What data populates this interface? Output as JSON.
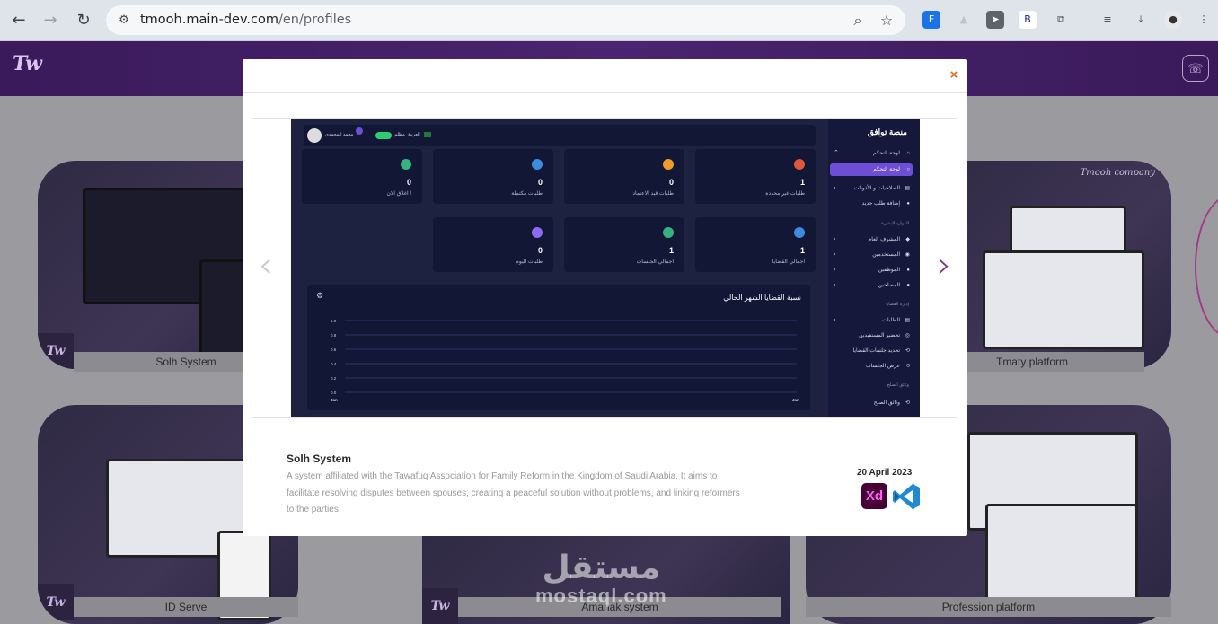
{
  "browser": {
    "url_host": "tmooh.main-dev.com",
    "url_path": "/en/profiles",
    "nav": {
      "back": "←",
      "forward": "→",
      "reload": "↻"
    },
    "omnibox_icons": [
      "site-info-icon",
      "zoom-icon",
      "star-icon"
    ],
    "extensions": [
      {
        "name": "translate-extension-icon",
        "glyph": "F",
        "bg": "#1a73e8",
        "fg": "#ffffff"
      },
      {
        "name": "gray-extension-icon",
        "glyph": "▲",
        "bg": "transparent",
        "fg": "#bfc3c9"
      },
      {
        "name": "cursor-extension-icon",
        "glyph": "➤",
        "bg": "#5f6368",
        "fg": "#ffffff"
      },
      {
        "name": "b-extension-icon",
        "glyph": "B",
        "bg": "#ffffff",
        "fg": "#1a237e"
      },
      {
        "name": "puzzle-icon",
        "glyph": "⧉",
        "bg": "transparent",
        "fg": "#3c4043"
      },
      {
        "name": "media-queue-icon",
        "glyph": "≡",
        "bg": "transparent",
        "fg": "#3c4043"
      },
      {
        "name": "download-icon",
        "glyph": "⤓",
        "bg": "transparent",
        "fg": "#3c4043"
      },
      {
        "name": "profile-avatar-icon",
        "glyph": "●",
        "bg": "#e8e8e8",
        "fg": "#333333"
      },
      {
        "name": "menu-kebab-icon",
        "glyph": "⋮",
        "bg": "transparent",
        "fg": "#3c4043"
      }
    ]
  },
  "site": {
    "logo": "Tw",
    "header_button_icon": "chat-icon",
    "cards": [
      {
        "label": "Solh System"
      },
      {
        "label": "Tmaty platform",
        "corner_text": "Tmooh company"
      },
      {
        "label": "ID Serve"
      },
      {
        "label": "Amanak system"
      },
      {
        "label": "Profession platform"
      }
    ],
    "watermark": {
      "arabic": "مستقل",
      "latin": "mostaql.com"
    }
  },
  "modal": {
    "close": "×",
    "carousel": {
      "prev": "‹",
      "next": "›"
    },
    "dashboard": {
      "brand": "منصة توافق",
      "user_name": "محمد المحمدي",
      "lang_label": "العربية",
      "mode_label": "مظلم",
      "stats_row1": [
        {
          "num": "1",
          "label": "طلبات غير محددة",
          "color": "#e0573d"
        },
        {
          "num": "0",
          "label": "طلبات قيد الاعتماد",
          "color": "#f09a2a"
        },
        {
          "num": "0",
          "label": "طلبات مكتملة",
          "color": "#3a8dde"
        },
        {
          "num": "0",
          "label": "اغلاق الان !",
          "color": "#36b37e"
        }
      ],
      "stats_row2": [
        {
          "num": "1",
          "label": "اجمالي القضايا",
          "color": "#3a8dde"
        },
        {
          "num": "1",
          "label": "اجمالي الجلسات",
          "color": "#36b37e"
        },
        {
          "num": "0",
          "label": "طلبات اليوم",
          "color": "#8b6cf0"
        }
      ],
      "chart": {
        "title": "نسبة القضايا الشهر الحالي",
        "y_ticks": [
          "1.0",
          "0.8",
          "0.6",
          "0.4",
          "0.2",
          "0.0"
        ],
        "x_ticks": [
          "Jan",
          "Jan"
        ]
      },
      "sidebar": {
        "items_top": [
          {
            "label": "لوحة التحكم",
            "icon": "⌂",
            "active": false,
            "chev": "⌃"
          },
          {
            "label": "لوحة التحكم",
            "icon": "○",
            "active": true,
            "chev": ""
          },
          {
            "label": "الصلاحيات و الأذونات",
            "icon": "▤",
            "active": false,
            "chev": "›"
          },
          {
            "label": "إضافة طلب جديد",
            "icon": "●",
            "active": false,
            "chev": ""
          }
        ],
        "section1": "الموارد البشرية",
        "items_hr": [
          {
            "label": "المشرف العام",
            "icon": "◆",
            "chev": "›"
          },
          {
            "label": "المستخدمين",
            "icon": "◉",
            "chev": "›"
          },
          {
            "label": "الموظفين",
            "icon": "●",
            "chev": "›"
          },
          {
            "label": "المصلحين",
            "icon": "●",
            "chev": "›"
          }
        ],
        "section2": "إدارة القضايا",
        "items_cases": [
          {
            "label": "الطلبات",
            "icon": "▤",
            "chev": "›"
          },
          {
            "label": "تحضير المستفيدين",
            "icon": "◎",
            "chev": ""
          },
          {
            "label": "تحديد جلسات القضايا",
            "icon": "⟲",
            "chev": ""
          },
          {
            "label": "عرض الجلسات",
            "icon": "⟲",
            "chev": ""
          }
        ],
        "section3": "وثائق الصلح",
        "items_docs": [
          {
            "label": "وثائق الصلح",
            "icon": "⟲",
            "chev": ""
          }
        ]
      }
    },
    "project": {
      "title": "Solh System",
      "description": "A system affiliated with the Tawafuq Association for Family Reform in the Kingdom of Saudi Arabia. It aims to facilitate resolving disputes between spouses, creating a peaceful solution without problems, and linking reformers to the parties.",
      "date": "20 April 2023",
      "tools": [
        {
          "name": "adobe-xd-icon",
          "text": "Xd"
        },
        {
          "name": "vscode-icon",
          "text": ""
        }
      ]
    }
  },
  "colors": {
    "accent": "#6c4fd6",
    "brand_purple": "#4a2470",
    "close_orange": "#e06a1a",
    "arrow_gray": "#c7c7c7",
    "arrow_purple": "#7a3b7a"
  }
}
